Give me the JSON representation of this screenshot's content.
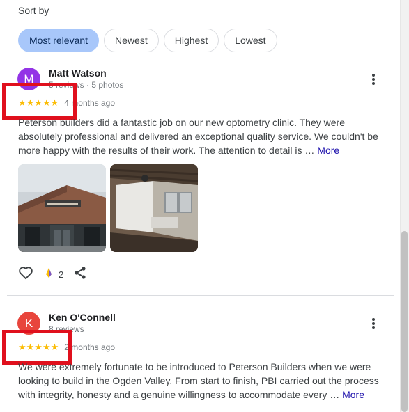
{
  "sort": {
    "label": "Sort by",
    "chips": [
      "Most relevant",
      "Newest",
      "Highest",
      "Lowest"
    ],
    "selected": "Most relevant"
  },
  "reviews": [
    {
      "avatar_letter": "M",
      "avatar_color": "#9334e6",
      "name": "Matt Watson",
      "meta": "5 reviews · 5 photos",
      "rating": 5,
      "stars": "★★★★★",
      "time": "4 months ago",
      "text": "Peterson builders did a fantastic job on our new optometry clinic. They were absolutely professional and delivered an exceptional quality service. We couldn't be more happy with the results of their work. The attention to detail is …",
      "more": "More",
      "reactions": "2"
    },
    {
      "avatar_letter": "K",
      "avatar_color": "#e8453c",
      "name": "Ken O'Connell",
      "meta": "8 reviews",
      "rating": 5,
      "stars": "★★★★★",
      "time": "2 months ago",
      "text": "We were extremely fortunate to be introduced to Peterson Builders when we were looking to build in the Ogden Valley. From start to finish, PBI carried out the process with integrity, honesty and a genuine willingness to accommodate every …",
      "more": "More"
    }
  ],
  "colors": {
    "highlight": "#e0101d",
    "star": "#fbbc04",
    "chip_active": "#a8c7fa",
    "link": "#1a0dab"
  }
}
